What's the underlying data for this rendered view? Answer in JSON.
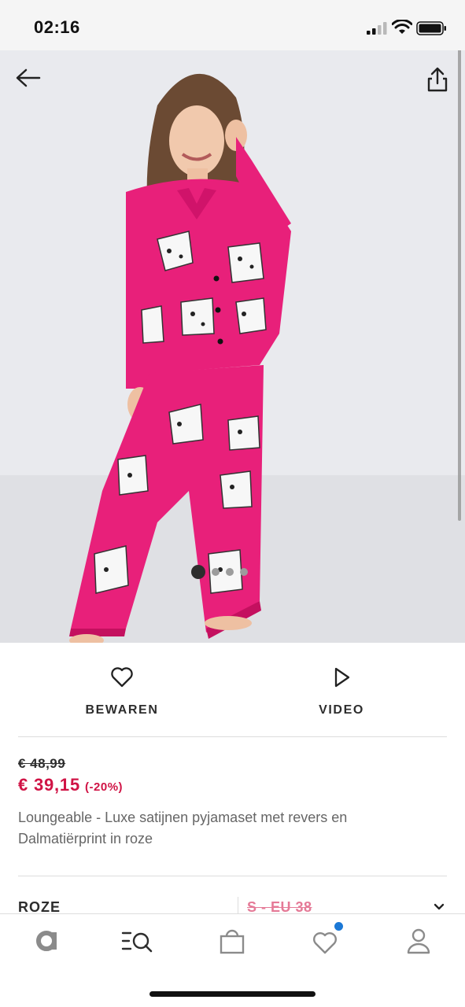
{
  "status_bar": {
    "time": "02:16"
  },
  "product": {
    "old_price": "€ 48,99",
    "new_price": "€ 39,15",
    "discount": "(-20%)",
    "title": "Loungeable - Luxe satijnen pyjamaset met revers en Dalmatiërprint in roze"
  },
  "actions": {
    "save_label": "BEWAREN",
    "video_label": "VIDEO"
  },
  "options": {
    "colour": "ROZE",
    "size": "S - EU 38"
  },
  "gallery": {
    "image_count": 4,
    "active_index": 0
  },
  "icons": [
    "back-arrow-icon",
    "share-icon",
    "heart-icon",
    "play-icon",
    "chevron-down-icon",
    "asos-logo-icon",
    "search-eq-icon",
    "bag-icon",
    "heart-icon",
    "account-icon"
  ],
  "colors": {
    "accent_price": "#d01345",
    "notification": "#1b78d6",
    "pajama": "#e8207a"
  }
}
